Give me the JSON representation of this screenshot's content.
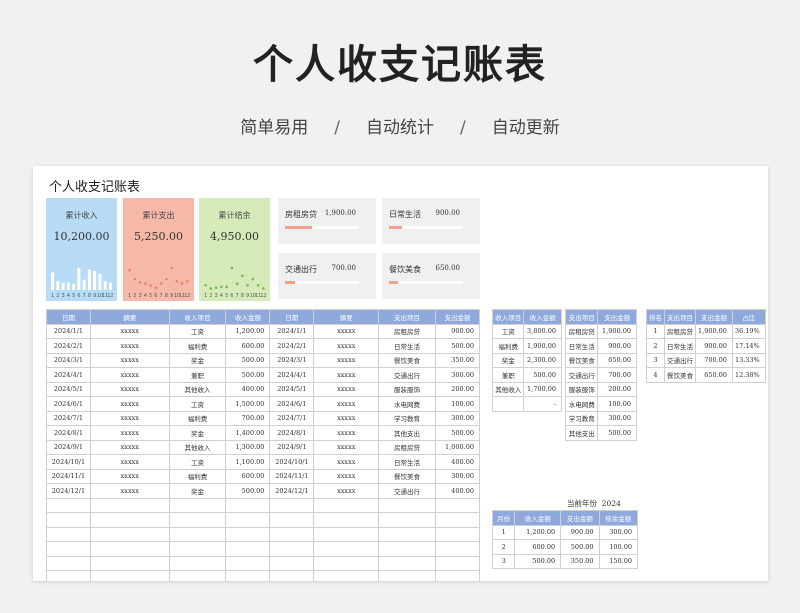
{
  "hero": {
    "title": "个人收支记账表",
    "sub1": "简单易用",
    "sub2": "自动统计",
    "sub3": "自动更新",
    "sep": "/"
  },
  "sheet": {
    "title": "个人收支记账表"
  },
  "cards": {
    "income": {
      "label": "累计收入",
      "value": "10,200.00",
      "color": "#b8dcf6"
    },
    "expense": {
      "label": "累计支出",
      "value": "5,250.00",
      "color": "#f6b9a9"
    },
    "balance": {
      "label": "累计结余",
      "value": "4,950.00",
      "color": "#d6ebb9"
    }
  },
  "spark_labels": [
    "1",
    "2",
    "3",
    "4",
    "5",
    "6",
    "7",
    "8",
    "9",
    "10",
    "11",
    "12"
  ],
  "mini_cards": [
    {
      "name": "房租房贷",
      "amount": "1,900.00",
      "fraction": 0.36
    },
    {
      "name": "日常生活",
      "amount": "900.00",
      "fraction": 0.17
    },
    {
      "name": "交通出行",
      "amount": "700.00",
      "fraction": 0.13
    },
    {
      "name": "餐饮美食",
      "amount": "650.00",
      "fraction": 0.12
    }
  ],
  "ledger": {
    "headers": [
      "日期",
      "摘要",
      "收入项目",
      "收入金额",
      "日期",
      "摘要",
      "支出项目",
      "支出金额"
    ],
    "rows": [
      [
        "2024/1/1",
        "xxxxx",
        "工资",
        "1,200.00",
        "2024/1/1",
        "xxxxx",
        "房租房贷",
        "900.00"
      ],
      [
        "2024/2/1",
        "xxxxx",
        "福利费",
        "600.00",
        "2024/2/1",
        "xxxxx",
        "日常生活",
        "500.00"
      ],
      [
        "2024/3/1",
        "xxxxx",
        "奖金",
        "500.00",
        "2024/3/1",
        "xxxxx",
        "餐饮美食",
        "350.00"
      ],
      [
        "2024/4/1",
        "xxxxx",
        "兼职",
        "500.00",
        "2024/4/1",
        "xxxxx",
        "交通出行",
        "300.00"
      ],
      [
        "2024/5/1",
        "xxxxx",
        "其他收入",
        "400.00",
        "2024/5/1",
        "xxxxx",
        "服装服饰",
        "200.00"
      ],
      [
        "2024/6/1",
        "xxxxx",
        "工资",
        "1,500.00",
        "2024/6/1",
        "xxxxx",
        "水电网费",
        "100.00"
      ],
      [
        "2024/7/1",
        "xxxxx",
        "福利费",
        "700.00",
        "2024/7/1",
        "xxxxx",
        "学习教育",
        "300.00"
      ],
      [
        "2024/8/1",
        "xxxxx",
        "奖金",
        "1,400.00",
        "2024/8/1",
        "xxxxx",
        "其他支出",
        "500.00"
      ],
      [
        "2024/9/1",
        "xxxxx",
        "其他收入",
        "1,300.00",
        "2024/9/1",
        "xxxxx",
        "房租房贷",
        "1,000.00"
      ],
      [
        "2024/10/1",
        "xxxxx",
        "工资",
        "1,100.00",
        "2024/10/1",
        "xxxxx",
        "日常生活",
        "400.00"
      ],
      [
        "2024/11/1",
        "xxxxx",
        "福利费",
        "600.00",
        "2024/11/1",
        "xxxxx",
        "餐饮美食",
        "300.00"
      ],
      [
        "2024/12/1",
        "xxxxx",
        "奖金",
        "500.00",
        "2024/12/1",
        "xxxxx",
        "交通出行",
        "400.00"
      ]
    ]
  },
  "income_summary": {
    "headers": [
      "收入项目",
      "收入金额"
    ],
    "rows": [
      [
        "工资",
        "3,800.00"
      ],
      [
        "福利费",
        "1,900.00"
      ],
      [
        "奖金",
        "2,300.00"
      ],
      [
        "兼职",
        "500.00"
      ],
      [
        "其他收入",
        "1,700.00"
      ],
      [
        "",
        "-"
      ]
    ]
  },
  "expense_summary": {
    "headers": [
      "支出项目",
      "支出金额"
    ],
    "rows": [
      [
        "房租房贷",
        "1,900.00"
      ],
      [
        "日常生活",
        "900.00"
      ],
      [
        "餐饮美食",
        "650.00"
      ],
      [
        "交通出行",
        "700.00"
      ],
      [
        "服装服饰",
        "200.00"
      ],
      [
        "水电网费",
        "100.00"
      ],
      [
        "学习教育",
        "300.00"
      ],
      [
        "其他支出",
        "500.00"
      ]
    ]
  },
  "ranking": {
    "headers": [
      "排名",
      "支出项目",
      "支出金额",
      "占比"
    ],
    "rows": [
      [
        "1",
        "房租房贷",
        "1,900.00",
        "36.19%"
      ],
      [
        "2",
        "日常生活",
        "900.00",
        "17.14%"
      ],
      [
        "3",
        "交通出行",
        "700.00",
        "13.33%"
      ],
      [
        "4",
        "餐饮美食",
        "650.00",
        "12.38%"
      ]
    ]
  },
  "monthly": {
    "year_label": "当前年份",
    "year": "2024",
    "headers": [
      "月份",
      "收入金额",
      "支出金额",
      "结余金额"
    ],
    "rows": [
      [
        "1",
        "1,200.00",
        "900.00",
        "300.00"
      ],
      [
        "2",
        "600.00",
        "500.00",
        "100.00"
      ],
      [
        "3",
        "500.00",
        "350.00",
        "150.00"
      ]
    ]
  },
  "chart_data": [
    {
      "type": "bar",
      "title": "累计收入",
      "categories": [
        "1",
        "2",
        "3",
        "4",
        "5",
        "6",
        "7",
        "8",
        "9",
        "10",
        "11",
        "12"
      ],
      "values": [
        1200,
        600,
        500,
        500,
        400,
        1500,
        700,
        1400,
        1300,
        1100,
        600,
        500
      ],
      "color": "#ffffff"
    },
    {
      "type": "scatter",
      "title": "累计支出",
      "categories": [
        "1",
        "2",
        "3",
        "4",
        "5",
        "6",
        "7",
        "8",
        "9",
        "10",
        "11",
        "12"
      ],
      "values": [
        900,
        500,
        350,
        300,
        200,
        100,
        300,
        500,
        1000,
        400,
        300,
        400
      ],
      "color": "#e8836c"
    },
    {
      "type": "scatter",
      "title": "累计结余",
      "categories": [
        "1",
        "2",
        "3",
        "4",
        "5",
        "6",
        "7",
        "8",
        "9",
        "10",
        "11",
        "12"
      ],
      "values": [
        300,
        100,
        150,
        200,
        200,
        1400,
        400,
        900,
        300,
        700,
        300,
        100
      ],
      "color": "#79b94a"
    }
  ]
}
